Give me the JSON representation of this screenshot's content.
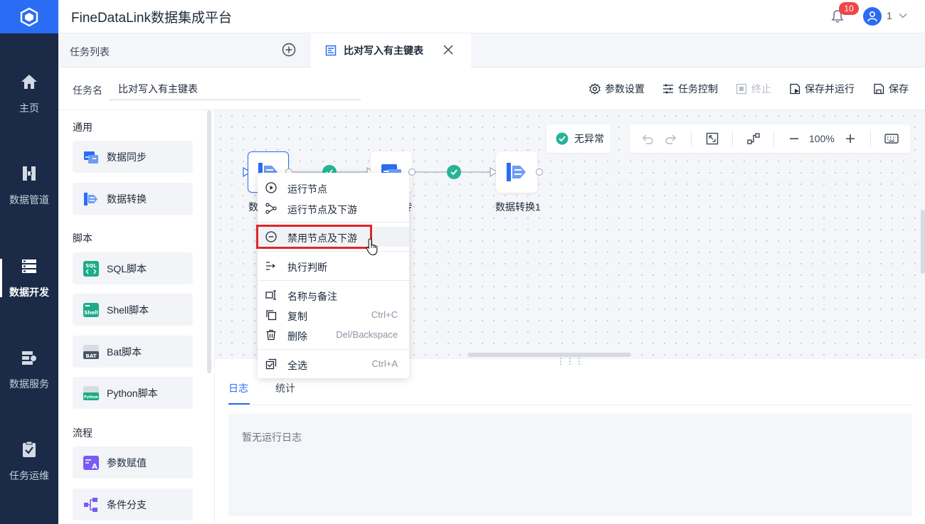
{
  "app": {
    "title": "FineDataLink数据集成平台"
  },
  "header": {
    "notification_count": "10",
    "user_name": "1"
  },
  "leftnav": {
    "items": [
      {
        "label": "主页",
        "icon": "home-icon"
      },
      {
        "label": "数据管道",
        "icon": "pipeline-icon"
      },
      {
        "label": "数据开发",
        "icon": "dev-icon",
        "active": true
      },
      {
        "label": "数据服务",
        "icon": "service-icon"
      },
      {
        "label": "任务运维",
        "icon": "ops-icon"
      }
    ]
  },
  "tabs": {
    "list_label": "任务列表",
    "active_tab": "比对写入有主键表"
  },
  "task": {
    "name_label": "任务名",
    "name_value": "比对写入有主键表",
    "actions": {
      "params": "参数设置",
      "control": "任务控制",
      "stop": "终止",
      "save_run": "保存并运行",
      "save": "保存"
    }
  },
  "components": {
    "sections": [
      {
        "title": "通用",
        "items": [
          "数据同步",
          "数据转换"
        ]
      },
      {
        "title": "脚本",
        "items": [
          "SQL脚本",
          "Shell脚本",
          "Bat脚本",
          "Python脚本"
        ]
      },
      {
        "title": "流程",
        "items": [
          "参数赋值",
          "条件分支"
        ]
      }
    ]
  },
  "canvas": {
    "status": "无异常",
    "zoom": "100%",
    "nodes": [
      {
        "label": "数"
      },
      {
        "label": "专"
      },
      {
        "label": "数据转换1"
      }
    ]
  },
  "context_menu": {
    "items": [
      {
        "label": "运行节点",
        "icon": "play-icon"
      },
      {
        "label": "运行节点及下游",
        "icon": "branch-icon"
      },
      {
        "label": "禁用节点及下游",
        "icon": "disable-icon"
      },
      {
        "label": "执行判断",
        "icon": "judge-icon"
      },
      {
        "label": "名称与备注",
        "icon": "rename-icon"
      },
      {
        "label": "复制",
        "icon": "copy-icon",
        "shortcut": "Ctrl+C"
      },
      {
        "label": "删除",
        "icon": "trash-icon",
        "shortcut": "Del/Backspace"
      },
      {
        "label": "全选",
        "icon": "select-all-icon",
        "shortcut": "Ctrl+A"
      }
    ]
  },
  "log": {
    "tabs": [
      "日志",
      "统计"
    ],
    "empty_text": "暂无运行日志"
  },
  "colors": {
    "accent": "#2a6df4",
    "nav_bg": "#1b2a47",
    "success": "#27b396",
    "highlight": "#e0262b"
  }
}
